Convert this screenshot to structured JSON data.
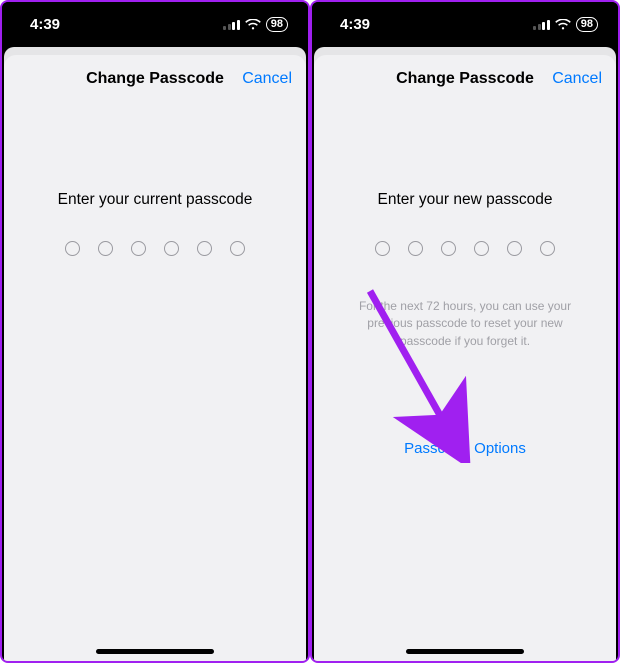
{
  "status": {
    "time": "4:39",
    "battery": "98"
  },
  "screen1": {
    "nav_title": "Change Passcode",
    "cancel": "Cancel",
    "prompt": "Enter your current passcode"
  },
  "screen2": {
    "nav_title": "Change Passcode",
    "cancel": "Cancel",
    "prompt": "Enter your new passcode",
    "helper": "For the next 72 hours, you can use your previous passcode to reset your new passcode if you forget it.",
    "options": "Passcode Options"
  },
  "colors": {
    "accent": "#007aff",
    "annotation": "#a020f0"
  }
}
